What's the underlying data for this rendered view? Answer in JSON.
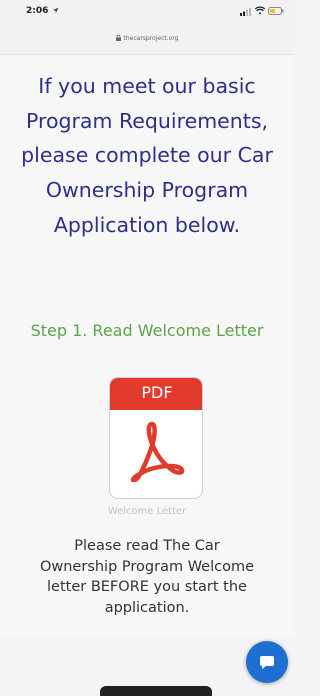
{
  "status_bar": {
    "time": "2:06",
    "icons": [
      "location-arrow-icon",
      "signal-icon",
      "wifi-icon",
      "battery-icon"
    ]
  },
  "browser": {
    "url": "thecarsproject.org",
    "icons": [
      "lock-icon"
    ]
  },
  "page": {
    "intro": "If you meet our basic Program Requirements, please complete our Car Ownership Program Application below.",
    "step_heading": "Step 1. Read Welcome Letter",
    "pdf_label": "PDF",
    "pdf_caption": "Welcome Letter",
    "body": "Please read The Car Ownership Program Welcome letter BEFORE you start the application."
  },
  "colors": {
    "heading_blue": "#2e2f8c",
    "step_green": "#5fa44a",
    "pdf_red": "#e23b2e",
    "chat_blue": "#1e6fd1"
  },
  "chat": {
    "icon": "chat-bubble-icon"
  }
}
